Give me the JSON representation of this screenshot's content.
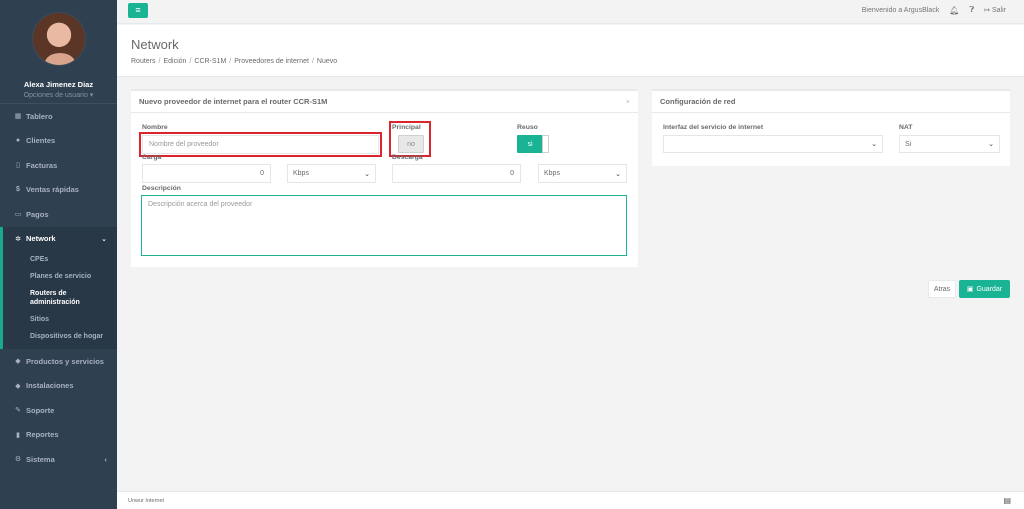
{
  "sidebar": {
    "user_name": "Alexa Jimenez Diaz",
    "user_options": "Opciones de usuario ▾",
    "items": [
      {
        "label": "Tablero",
        "icon": "dashboard-icon"
      },
      {
        "label": "Clientes",
        "icon": "users-icon"
      },
      {
        "label": "Facturas",
        "icon": "file-icon"
      },
      {
        "label": "Ventas rápidas",
        "icon": "dollar-icon"
      },
      {
        "label": "Pagos",
        "icon": "money-icon"
      },
      {
        "label": "Network",
        "icon": "network-icon"
      },
      {
        "label": "Productos y servicios",
        "icon": "tag-icon"
      },
      {
        "label": "Instalaciones",
        "icon": "tag-icon"
      },
      {
        "label": "Soporte",
        "icon": "wrench-icon"
      },
      {
        "label": "Reportes",
        "icon": "book-icon"
      },
      {
        "label": "Sistema",
        "icon": "gears-icon"
      }
    ],
    "network_sub": [
      "CPEs",
      "Planes de servicio",
      "Routers de administración",
      "Sitios",
      "Dispositivos de hogar"
    ]
  },
  "topbar": {
    "welcome": "Bienvenido a ArgusBlack",
    "logout": "Salir"
  },
  "heading": {
    "title": "Network",
    "breadcrumbs": [
      "Routers",
      "Edición",
      "CCR-S1M",
      "Proveedores de internet",
      "Nuevo"
    ]
  },
  "provider_panel": {
    "title": "Nuevo proveedor de internet para el router CCR-S1M",
    "nombre_label": "Nombre",
    "nombre_placeholder": "Nombre del proveedor",
    "principal_label": "Principal",
    "principal_value": "no",
    "reuso_label": "Reuso",
    "reuso_value": "si",
    "carga_label": "Carga",
    "carga_value": "0",
    "carga_unit": "Kbps",
    "descarga_label": "Descarga",
    "descarga_value": "0",
    "descarga_unit": "Kbps",
    "descripcion_label": "Descripción",
    "descripcion_placeholder": "Descripción acerca del proveedor"
  },
  "network_panel": {
    "title": "Configuración de red",
    "interface_label": "Interfaz del servicio de internet",
    "interface_value": "",
    "nat_label": "NAT",
    "nat_value": "Si"
  },
  "actions": {
    "back": "Atras",
    "save": "Guardar"
  },
  "footer": {
    "text": "Unwur Internet"
  },
  "colors": {
    "accent": "#1ab394",
    "sidebar": "#2f4050",
    "highlight": "#d9252b"
  }
}
